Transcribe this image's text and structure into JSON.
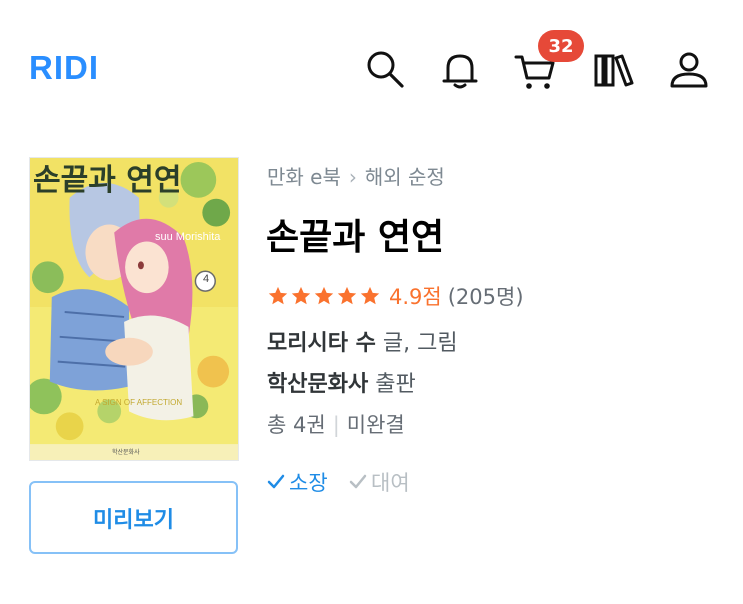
{
  "header": {
    "logo": "RIDI",
    "cart_count": "32",
    "icons": [
      "search-icon",
      "bell-icon",
      "cart-icon",
      "library-icon",
      "user-icon"
    ]
  },
  "book": {
    "breadcrumb": [
      "만화 e북",
      "해외 순정"
    ],
    "breadcrumb_separator": "›",
    "title": "손끝과 연연",
    "rating": {
      "stars": 5,
      "score": "4.9점",
      "count": "(205명)"
    },
    "author": {
      "name": "모리시타 수",
      "role": "글, 그림"
    },
    "publisher": {
      "name": "학산문화사",
      "role": "출판"
    },
    "volumes": "총 4권",
    "divider": "|",
    "status": "미완결",
    "options": {
      "own": "소장",
      "rent": "대여"
    },
    "preview_label": "미리보기",
    "cover": {
      "title": "손끝과 연연",
      "author_en": "suu Morishita",
      "volume": "4",
      "subtitle": "A SIGN OF AFFECTION",
      "publisher_mark": "학산문화사"
    }
  },
  "colors": {
    "brand": "#2a8eff",
    "accent_blue": "#1f8ce6",
    "rating_orange": "#fa722e",
    "badge_red": "#e64938"
  }
}
